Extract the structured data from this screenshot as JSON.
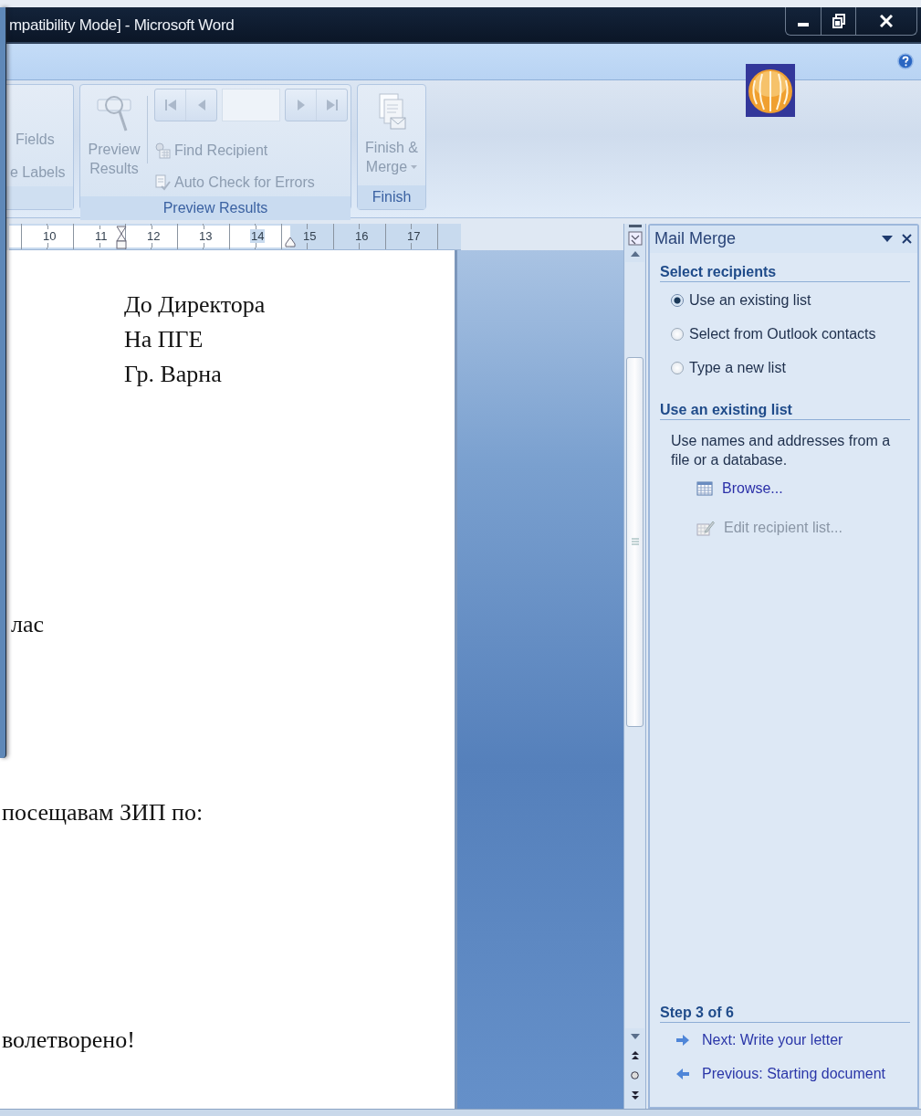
{
  "window": {
    "title": "mpatibility Mode] - Microsoft Word"
  },
  "ribbon": {
    "groups": [
      {
        "kind": "partial",
        "controls": [
          {
            "kind": "small",
            "label": "Fields",
            "disabled": true
          },
          {
            "kind": "small",
            "label": "e Labels",
            "disabled": true
          }
        ]
      },
      {
        "kind": "full",
        "label": "Preview Results",
        "controls": [
          {
            "kind": "large",
            "label": "Preview Results",
            "disabled": true,
            "dropdown": false
          },
          {
            "kind": "nav",
            "disabled": true
          },
          {
            "kind": "small",
            "label": "Find Recipient",
            "disabled": true
          },
          {
            "kind": "small",
            "label": "Auto Check for Errors",
            "disabled": true
          }
        ]
      },
      {
        "kind": "full",
        "label": "Finish",
        "controls": [
          {
            "kind": "large",
            "label": "Finish & Merge",
            "disabled": true,
            "dropdown": true
          }
        ]
      }
    ]
  },
  "ruler": {
    "numbers": [
      "10",
      "11",
      "12",
      "13",
      "14",
      "15",
      "16",
      "17"
    ]
  },
  "document": {
    "paragraphs": [
      {
        "kind": "address",
        "text": "До Директора"
      },
      {
        "kind": "address",
        "text": "На ПГЕ"
      },
      {
        "kind": "address",
        "text": "Гр. Варна"
      },
      {
        "kind": "body",
        "text": "лас"
      },
      {
        "kind": "body",
        "text": "посещавам ЗИП по:"
      },
      {
        "kind": "body",
        "text": "волетворено!"
      }
    ]
  },
  "task_pane": {
    "title": "Mail Merge",
    "sections": [
      {
        "heading": "Select recipients",
        "items": [
          {
            "kind": "radio",
            "label": "Use an existing list",
            "selected": true
          },
          {
            "kind": "radio",
            "label": "Select from Outlook contacts",
            "selected": false
          },
          {
            "kind": "radio",
            "label": "Type a new list",
            "selected": false
          }
        ]
      },
      {
        "heading": "Use an existing list",
        "items": [
          {
            "kind": "text",
            "text": "Use names and addresses from a file or a database."
          },
          {
            "kind": "link",
            "label": "Browse...",
            "disabled": false
          },
          {
            "kind": "link",
            "label": "Edit recipient list...",
            "disabled": true
          }
        ]
      }
    ],
    "footer": {
      "heading": "Step 3 of 6",
      "items": [
        {
          "kind": "next",
          "label": "Next: Write your letter"
        },
        {
          "kind": "previous",
          "label": "Previous: Starting document"
        }
      ]
    }
  }
}
